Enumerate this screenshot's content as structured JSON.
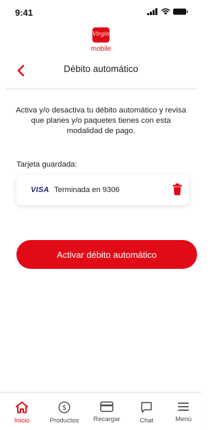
{
  "status_bar": {
    "time": "9:41"
  },
  "logo": {
    "script_text": "Virgin",
    "word": "mobile"
  },
  "header": {
    "title": "Débito automático"
  },
  "main": {
    "description": "Activa y/o desactiva tu débito automático y revisa que planes y/o paquetes tienes con esta modalidad de pago.",
    "saved_card_label": "Tarjeta guardada:",
    "card": {
      "brand": "VISA",
      "text": "Terminada en 9306"
    },
    "activate_button": "Activar débito automático"
  },
  "bottom_nav": {
    "items": [
      {
        "label": "Inicio",
        "icon": "home-icon",
        "active": true
      },
      {
        "label": "Productos",
        "icon": "dollar-coin-icon",
        "active": false
      },
      {
        "label": "Recargar",
        "icon": "credit-card-icon",
        "active": false
      },
      {
        "label": "Chat",
        "icon": "chat-bubble-icon",
        "active": false
      },
      {
        "label": "Menú",
        "icon": "hamburger-menu-icon",
        "active": false
      }
    ]
  },
  "colors": {
    "brand_red": "#e10a17",
    "text": "#1e1e1e",
    "visa_blue": "#1a1f71"
  }
}
